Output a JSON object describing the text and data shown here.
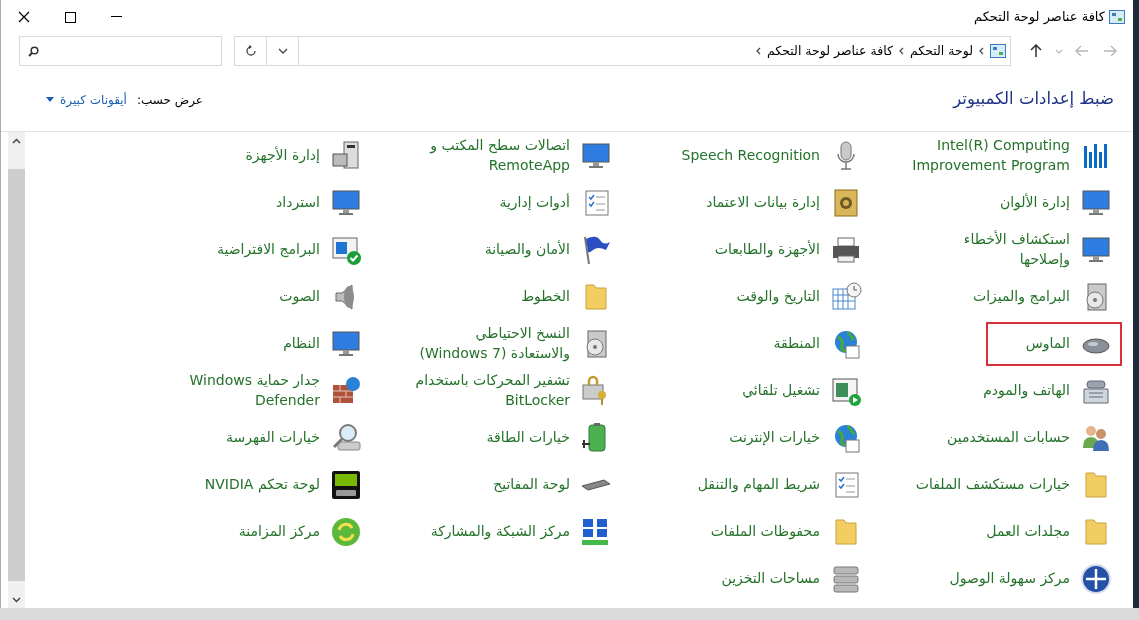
{
  "window": {
    "title": "كافة عناصر لوحة التحكم"
  },
  "nav_buttons": [
    {
      "kind": "back",
      "disabled": true
    },
    {
      "kind": "forward",
      "disabled": true
    },
    {
      "kind": "recent",
      "disabled": true
    },
    {
      "kind": "up",
      "disabled": false
    }
  ],
  "address_bar": {
    "breadcrumbs": [
      "لوحة التحكم",
      "كافة عناصر لوحة التحكم"
    ]
  },
  "header": {
    "title": "ضبط إعدادات الكمبيوتر",
    "view_by_label": "عرض حسب:",
    "view_by_value": "أيقونات كبيرة"
  },
  "items": [
    {
      "label": "Intel(R) Computing Improvement Program",
      "highlighted": false
    },
    {
      "label": "Speech Recognition",
      "highlighted": false
    },
    {
      "label": "اتصالات سطح المكتب و RemoteApp",
      "highlighted": false
    },
    {
      "label": "إدارة الأجهزة",
      "highlighted": false
    },
    {
      "label": "إدارة الألوان",
      "highlighted": false
    },
    {
      "label": "إدارة بيانات الاعتماد",
      "highlighted": false
    },
    {
      "label": "أدوات إدارية",
      "highlighted": false
    },
    {
      "label": "استرداد",
      "highlighted": false
    },
    {
      "label": "استكشاف الأخطاء وإصلاحها",
      "highlighted": false
    },
    {
      "label": "الأجهزة والطابعات",
      "highlighted": false
    },
    {
      "label": "الأمان والصيانة",
      "highlighted": false
    },
    {
      "label": "البرامج الافتراضية",
      "highlighted": false
    },
    {
      "label": "البرامج والميزات",
      "highlighted": false
    },
    {
      "label": "التاريخ والوقت",
      "highlighted": false
    },
    {
      "label": "الخطوط",
      "highlighted": false
    },
    {
      "label": "الصوت",
      "highlighted": false
    },
    {
      "label": "الماوس",
      "highlighted": true
    },
    {
      "label": "المنطقة",
      "highlighted": false
    },
    {
      "label": "النسخ الاحتياطي والاستعادة (Windows 7)",
      "highlighted": false
    },
    {
      "label": "النظام",
      "highlighted": false
    },
    {
      "label": "الهاتف والمودم",
      "highlighted": false
    },
    {
      "label": "تشغيل تلقائي",
      "highlighted": false
    },
    {
      "label": "تشفير المحركات باستخدام BitLocker",
      "highlighted": false
    },
    {
      "label": "جدار حماية Windows Defender",
      "highlighted": false
    },
    {
      "label": "حسابات المستخدمين",
      "highlighted": false
    },
    {
      "label": "خيارات الإنترنت",
      "highlighted": false
    },
    {
      "label": "خيارات الطاقة",
      "highlighted": false
    },
    {
      "label": "خيارات الفهرسة",
      "highlighted": false
    },
    {
      "label": "خيارات مستكشف الملفات",
      "highlighted": false
    },
    {
      "label": "شريط المهام والتنقل",
      "highlighted": false
    },
    {
      "label": "لوحة المفاتيح",
      "highlighted": false
    },
    {
      "label": "لوحة تحكم NVIDIA",
      "highlighted": false
    },
    {
      "label": "مجلدات العمل",
      "highlighted": false
    },
    {
      "label": "محفوظات الملفات",
      "highlighted": false
    },
    {
      "label": "مركز الشبكة والمشاركة",
      "highlighted": false
    },
    {
      "label": "مركز المزامنة",
      "highlighted": false
    },
    {
      "label": "مركز سهولة الوصول",
      "highlighted": false
    },
    {
      "label": "مساحات التخزين",
      "highlighted": false
    }
  ]
}
